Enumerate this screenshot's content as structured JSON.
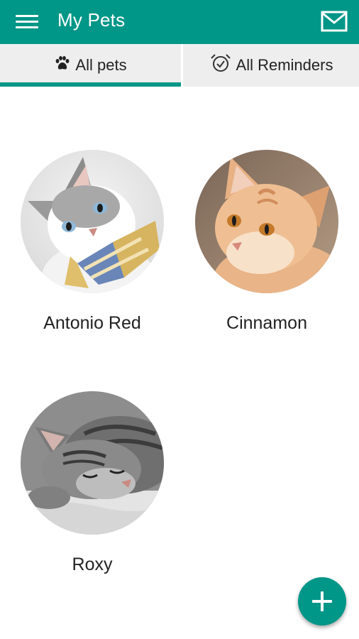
{
  "app_bar": {
    "title": "My Pets",
    "menu_icon": "hamburger-menu-icon",
    "mail_icon": "envelope-icon",
    "color": "#009688"
  },
  "tabs": [
    {
      "label": "All pets",
      "icon": "paw-icon",
      "selected": true
    },
    {
      "label": "All Reminders",
      "icon": "alarm-clock-icon",
      "selected": false
    }
  ],
  "pets": [
    {
      "name": "Antonio Red",
      "photo": "white-grey cat with bow tie"
    },
    {
      "name": "Cinnamon",
      "photo": "orange tabby cat"
    },
    {
      "name": "Roxy",
      "photo": "grey tabby cat sleeping"
    }
  ],
  "fab": {
    "icon": "plus-icon",
    "color": "#009688"
  }
}
